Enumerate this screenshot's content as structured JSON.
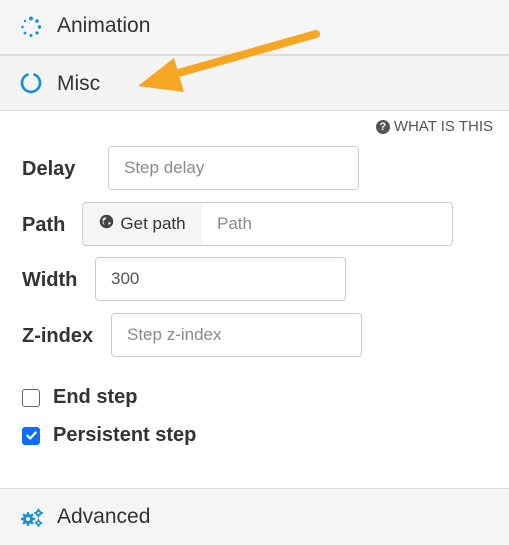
{
  "sections": {
    "animation": {
      "label": "Animation",
      "icon": "spinner-dots-icon"
    },
    "misc": {
      "label": "Misc",
      "icon": "circle-notch-icon"
    },
    "advanced": {
      "label": "Advanced",
      "icon": "gears-icon"
    }
  },
  "help": {
    "label": "WHAT IS THIS",
    "icon": "question-circle-icon"
  },
  "form": {
    "delay": {
      "label": "Delay",
      "placeholder": "Step delay",
      "value": ""
    },
    "path": {
      "label": "Path",
      "button_label": "Get path",
      "button_icon": "globe-icon",
      "placeholder": "Path",
      "value": ""
    },
    "width": {
      "label": "Width",
      "placeholder": "",
      "value": "300"
    },
    "zindex": {
      "label": "Z-index",
      "placeholder": "Step z-index",
      "value": ""
    }
  },
  "checkboxes": {
    "end_step": {
      "label": "End step",
      "checked": false
    },
    "persistent_step": {
      "label": "Persistent step",
      "checked": true
    }
  },
  "colors": {
    "accent": "#0d6efd",
    "icon_blue": "#1a8fd6",
    "arrow": "#f5a623"
  }
}
